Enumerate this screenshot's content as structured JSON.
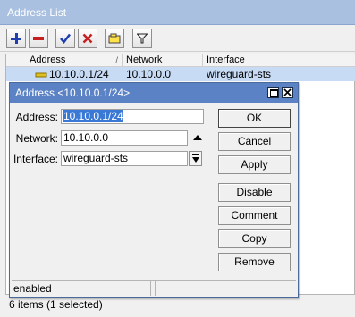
{
  "outer_window": {
    "title": "Address List",
    "toolbar": {
      "add_icon": "plus-icon",
      "remove_icon": "minus-icon",
      "enable_icon": "check-icon",
      "disable_icon": "x-icon",
      "comment_icon": "note-icon",
      "filter_icon": "filter-icon"
    },
    "columns": [
      "Address",
      "Network",
      "Interface"
    ],
    "rows": [
      {
        "address": "10.10.0.1/24",
        "network": "10.10.0.0",
        "interface": "wireguard-sts"
      }
    ],
    "status": "6 items (1 selected)"
  },
  "dialog": {
    "title": "Address <10.10.0.1/24>",
    "fields": {
      "address_label": "Address:",
      "address_value": "10.10.0.1/24",
      "network_label": "Network:",
      "network_value": "10.10.0.0",
      "interface_label": "Interface:",
      "interface_value": "wireguard-sts"
    },
    "buttons": {
      "ok": "OK",
      "cancel": "Cancel",
      "apply": "Apply",
      "disable": "Disable",
      "comment": "Comment",
      "copy": "Copy",
      "remove": "Remove"
    },
    "status": "enabled"
  },
  "colors": {
    "outer_title": "#a9c0e0",
    "dialog_title": "#5a82c4",
    "selected_row": "#c7dbf5",
    "selection": "#3a78d6"
  }
}
